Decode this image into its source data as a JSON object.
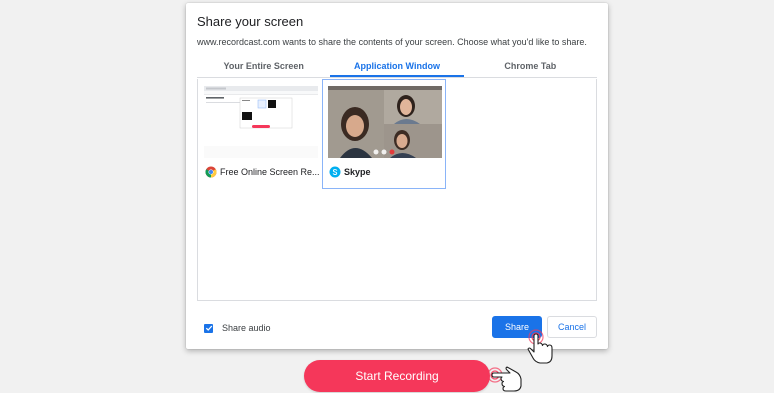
{
  "dialog": {
    "title": "Share your screen",
    "subtitle": "www.recordcast.com wants to share the contents of your screen. Choose what you'd like to share.",
    "tabs": [
      {
        "label": "Your Entire Screen",
        "active": false
      },
      {
        "label": "Application Window",
        "active": true
      },
      {
        "label": "Chrome Tab",
        "active": false
      }
    ],
    "items": [
      {
        "label": "Free Online Screen Re...",
        "icon": "chrome-icon",
        "selected": false
      },
      {
        "label": "Skype",
        "icon": "skype-icon",
        "selected": true
      }
    ],
    "share_audio_label": "Share audio",
    "share_audio_checked": true,
    "share_label": "Share",
    "cancel_label": "Cancel"
  },
  "start_recording_label": "Start Recording",
  "colors": {
    "accent": "#1a73e8",
    "record": "#f5375a",
    "background": "#f1f1f1"
  }
}
